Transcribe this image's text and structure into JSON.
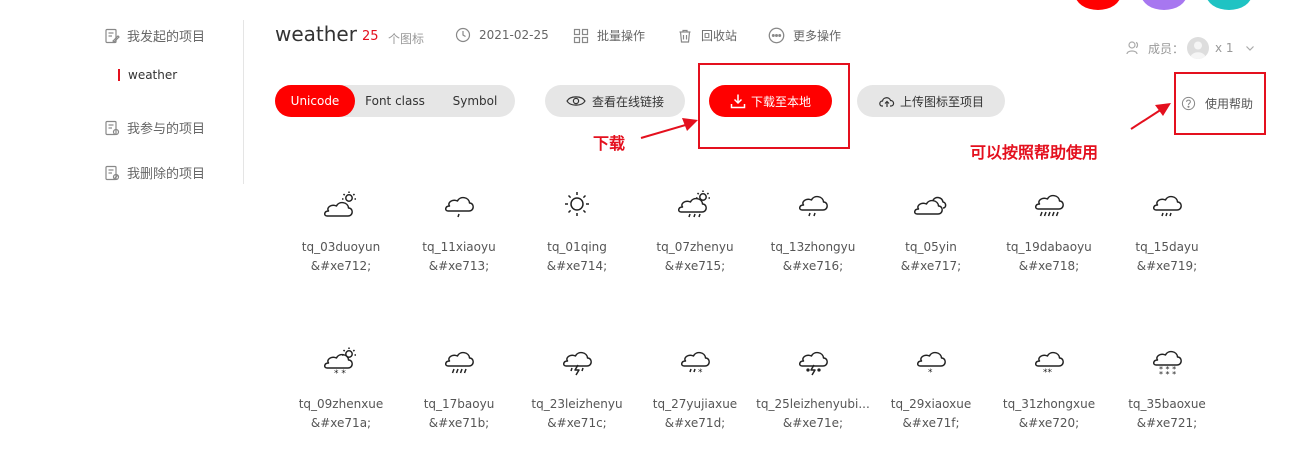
{
  "sidebar": {
    "items": [
      {
        "label": "我发起的项目",
        "icon": "edit-doc-icon"
      },
      {
        "label": "weather"
      },
      {
        "label": "我参与的项目",
        "icon": "participate-doc-icon"
      },
      {
        "label": "我删除的项目",
        "icon": "deleted-doc-icon"
      }
    ]
  },
  "header": {
    "title": "weather",
    "count": "25",
    "count_unit": "个图标",
    "date": "2021-02-25",
    "batch": "批量操作",
    "recycle": "回收站",
    "more": "更多操作",
    "members_label": "成员：",
    "members_count": "x 1"
  },
  "toolbar": {
    "tabs": [
      "Unicode",
      "Font class",
      "Symbol"
    ],
    "active_tab": "Unicode",
    "view_online": "查看在线链接",
    "download": "下载至本地",
    "upload": "上传图标至项目",
    "help": "使用帮助"
  },
  "annotations": {
    "download_text": "下载",
    "help_text": "可以按照帮助使用"
  },
  "colors": {
    "accent": "#ff0000",
    "annotation": "#e4101e"
  },
  "icons": [
    {
      "name": "tq_03duoyun",
      "code": "&#xe712;",
      "glyph": "cloud-sun-icon"
    },
    {
      "name": "tq_11xiaoyu",
      "code": "&#xe713;",
      "glyph": "cloud-light-rain-icon"
    },
    {
      "name": "tq_01qing",
      "code": "&#xe714;",
      "glyph": "sun-icon"
    },
    {
      "name": "tq_07zhenyu",
      "code": "&#xe715;",
      "glyph": "cloud-sun-rain-icon"
    },
    {
      "name": "tq_13zhongyu",
      "code": "&#xe716;",
      "glyph": "cloud-moderate-rain-icon"
    },
    {
      "name": "tq_05yin",
      "code": "&#xe717;",
      "glyph": "overcast-icon"
    },
    {
      "name": "tq_19dabaoyu",
      "code": "&#xe718;",
      "glyph": "cloud-heavy-rain-icon"
    },
    {
      "name": "tq_15dayu",
      "code": "&#xe719;",
      "glyph": "cloud-rain-icon"
    },
    {
      "name": "tq_09zhenxue",
      "code": "&#xe71a;",
      "glyph": "cloud-sun-snow-icon"
    },
    {
      "name": "tq_17baoyu",
      "code": "&#xe71b;",
      "glyph": "cloud-storm-rain-icon"
    },
    {
      "name": "tq_23leizhenyu",
      "code": "&#xe71c;",
      "glyph": "thunder-rain-icon"
    },
    {
      "name": "tq_27yujiaxue",
      "code": "&#xe71d;",
      "glyph": "sleet-icon"
    },
    {
      "name": "tq_25leizhenyubi...",
      "code": "&#xe71e;",
      "glyph": "thunder-hail-icon"
    },
    {
      "name": "tq_29xiaoxue",
      "code": "&#xe71f;",
      "glyph": "light-snow-icon"
    },
    {
      "name": "tq_31zhongxue",
      "code": "&#xe720;",
      "glyph": "moderate-snow-icon"
    },
    {
      "name": "tq_35baoxue",
      "code": "&#xe721;",
      "glyph": "blizzard-icon"
    }
  ]
}
